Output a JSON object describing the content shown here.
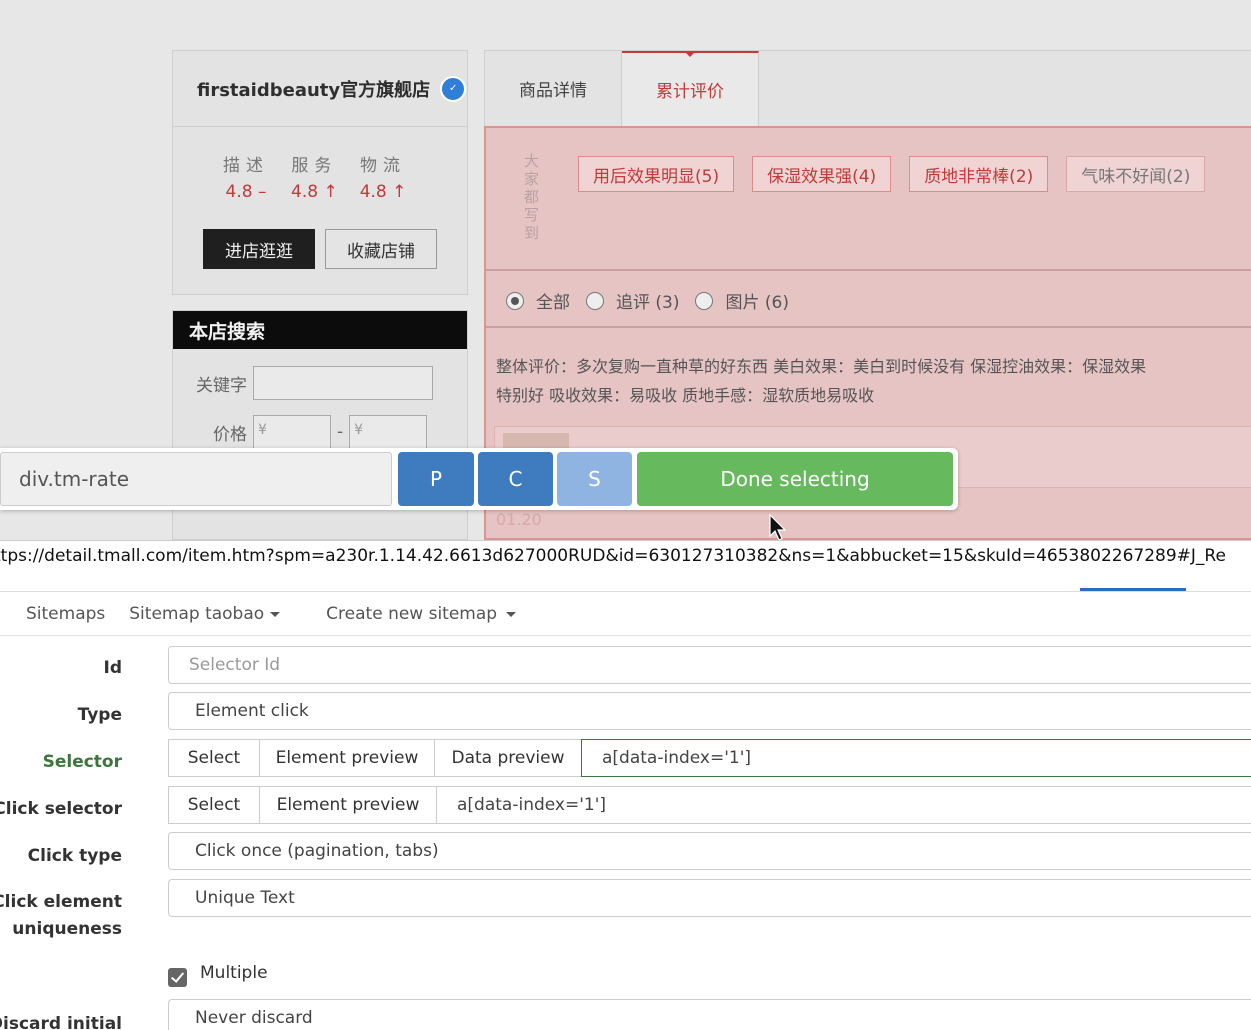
{
  "shop": {
    "name": "firstaidbeauty官方旗舰店",
    "ratings": [
      {
        "label": "描述",
        "value": "4.8 –"
      },
      {
        "label": "服务",
        "value": "4.8 ↑"
      },
      {
        "label": "物流",
        "value": "4.8 ↑"
      }
    ],
    "enter_shop": "进店逛逛",
    "fav_shop": "收藏店铺"
  },
  "shop_search": {
    "title": "本店搜索",
    "keyword_label": "关键字",
    "price_label": "价格",
    "price_min_placeholder": "¥",
    "price_max_placeholder": "¥",
    "dash": "-"
  },
  "product_tabs": [
    "商品详情",
    "累计评价"
  ],
  "rates": {
    "vertical_label": "大家都写到",
    "tags": [
      "用后效果明显(5)",
      "保湿效果强(4)",
      "质地非常棒(2)",
      "气味不好闻(2)"
    ],
    "filters": [
      "全部",
      "追评 (3)",
      "图片 (6)"
    ],
    "review_line1": "整体评价：多次复购一直种草的好东西 美白效果：美白到时候没有 保湿控油效果：保湿效果",
    "review_line2": "特别好 吸收效果：易吸收 质地手感：湿软质地易吸收",
    "review_date": "01.20"
  },
  "selector_bar": {
    "value": "div.tm-rate",
    "p": "P",
    "c": "C",
    "s": "S",
    "done": "Done selecting"
  },
  "status_url": "ttps://detail.tmall.com/item.htm?spm=a230r.1.14.42.6613d627000RUD&id=630127310382&ns=1&abbucket=15&skuId=4653802267289#J_Re",
  "scraper": {
    "nav": {
      "sitemaps": "Sitemaps",
      "sitemap_taobao": "Sitemap taobao",
      "create_new": "Create new sitemap"
    },
    "labels": {
      "id": "Id",
      "type": "Type",
      "selector": "Selector",
      "click_selector": "Click selector",
      "click_type": "Click type",
      "click_uniqueness_1": "Click element",
      "click_uniqueness_2": "uniqueness",
      "discard_initial": "Discard initial"
    },
    "id_placeholder": "Selector Id",
    "type_value": "Element click",
    "select_btn": "Select",
    "element_preview_btn": "Element preview",
    "data_preview_btn": "Data preview",
    "selector_value": "a[data-index='1']",
    "click_selector_value": "a[data-index='1']",
    "click_type_value": "Click once (pagination, tabs)",
    "uniqueness_value": "Unique Text",
    "multiple_label": "Multiple",
    "discard_value": "Never discard"
  },
  "colors": {
    "accent_red": "#c23a3a",
    "primary_blue": "#3f7bbf",
    "done_green": "#66b95d",
    "selector_label_green": "#3c763d"
  }
}
